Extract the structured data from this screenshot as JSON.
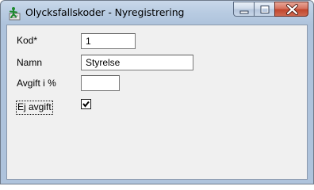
{
  "window": {
    "title": "Olycksfallskoder - Nyregistrering",
    "icon": "app-icon-green-figure"
  },
  "caption_buttons": {
    "minimize_icon": "minimize-icon",
    "maximize_icon": "maximize-icon",
    "close_icon": "close-icon"
  },
  "form": {
    "kod": {
      "label": "Kod*",
      "value": "1"
    },
    "namn": {
      "label": "Namn",
      "value": "Styrelse"
    },
    "avgift": {
      "label": "Avgift i %",
      "value": ""
    },
    "ej_avgift": {
      "label": "Ej avgift",
      "checked": true
    }
  },
  "colors": {
    "frame": "#aec3dc",
    "client_background": "#f0f0f0",
    "close_button": "#c1462d"
  }
}
